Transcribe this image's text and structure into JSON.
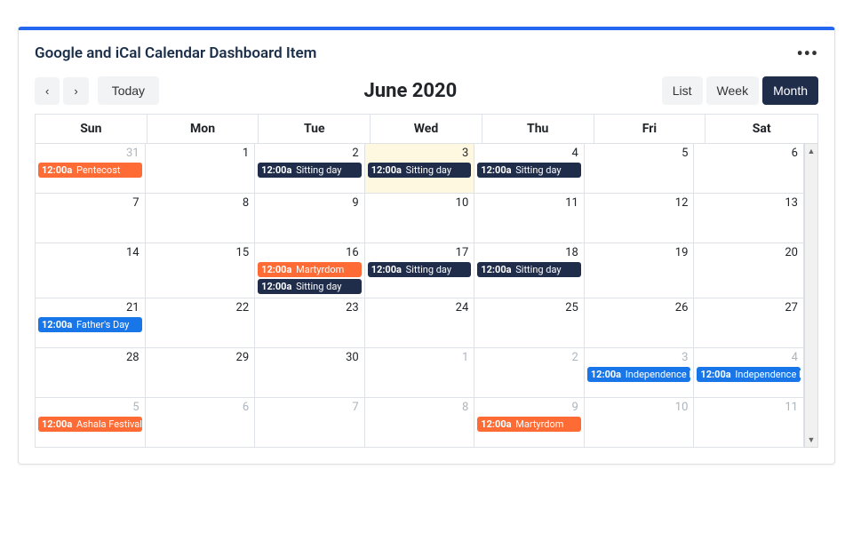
{
  "header": {
    "title": "Google and iCal Calendar Dashboard Item",
    "more_icon": "•••"
  },
  "toolbar": {
    "prev": "‹",
    "next": "›",
    "today": "Today",
    "title": "June 2020",
    "views": {
      "list": "List",
      "week": "Week",
      "month": "Month"
    }
  },
  "dayLabels": [
    "Sun",
    "Mon",
    "Tue",
    "Wed",
    "Thu",
    "Fri",
    "Sat"
  ],
  "eventTime": "12:00a",
  "weeks": [
    [
      {
        "n": "31",
        "muted": true,
        "events": [
          {
            "title": "Pentecost",
            "c": "orange"
          }
        ]
      },
      {
        "n": "1"
      },
      {
        "n": "2",
        "events": [
          {
            "title": "Sitting day",
            "c": "navy"
          }
        ]
      },
      {
        "n": "3",
        "today": true,
        "events": [
          {
            "title": "Sitting day",
            "c": "navy"
          }
        ]
      },
      {
        "n": "4",
        "events": [
          {
            "title": "Sitting day",
            "c": "navy"
          }
        ]
      },
      {
        "n": "5"
      },
      {
        "n": "6"
      }
    ],
    [
      {
        "n": "7"
      },
      {
        "n": "8"
      },
      {
        "n": "9"
      },
      {
        "n": "10"
      },
      {
        "n": "11"
      },
      {
        "n": "12"
      },
      {
        "n": "13"
      }
    ],
    [
      {
        "n": "14"
      },
      {
        "n": "15"
      },
      {
        "n": "16",
        "events": [
          {
            "title": "Martyrdom",
            "c": "orange"
          },
          {
            "title": "Sitting day",
            "c": "navy"
          }
        ]
      },
      {
        "n": "17",
        "events": [
          {
            "title": "Sitting day",
            "c": "navy"
          }
        ]
      },
      {
        "n": "18",
        "events": [
          {
            "title": "Sitting day",
            "c": "navy"
          }
        ]
      },
      {
        "n": "19"
      },
      {
        "n": "20"
      }
    ],
    [
      {
        "n": "21",
        "events": [
          {
            "title": "Father's Day",
            "c": "blue"
          }
        ]
      },
      {
        "n": "22"
      },
      {
        "n": "23"
      },
      {
        "n": "24"
      },
      {
        "n": "25"
      },
      {
        "n": "26"
      },
      {
        "n": "27"
      }
    ],
    [
      {
        "n": "28"
      },
      {
        "n": "29"
      },
      {
        "n": "30"
      },
      {
        "n": "1",
        "muted": true
      },
      {
        "n": "2",
        "muted": true
      },
      {
        "n": "3",
        "muted": true,
        "events": [
          {
            "title": "Independence Day",
            "c": "blue"
          }
        ]
      },
      {
        "n": "4",
        "muted": true,
        "events": [
          {
            "title": "Independence Day",
            "c": "blue"
          }
        ]
      }
    ],
    [
      {
        "n": "5",
        "muted": true,
        "events": [
          {
            "title": "Ashala Festival",
            "c": "orange"
          }
        ]
      },
      {
        "n": "6",
        "muted": true
      },
      {
        "n": "7",
        "muted": true
      },
      {
        "n": "8",
        "muted": true
      },
      {
        "n": "9",
        "muted": true,
        "events": [
          {
            "title": "Martyrdom",
            "c": "orange"
          }
        ]
      },
      {
        "n": "10",
        "muted": true
      },
      {
        "n": "11",
        "muted": true
      }
    ]
  ]
}
